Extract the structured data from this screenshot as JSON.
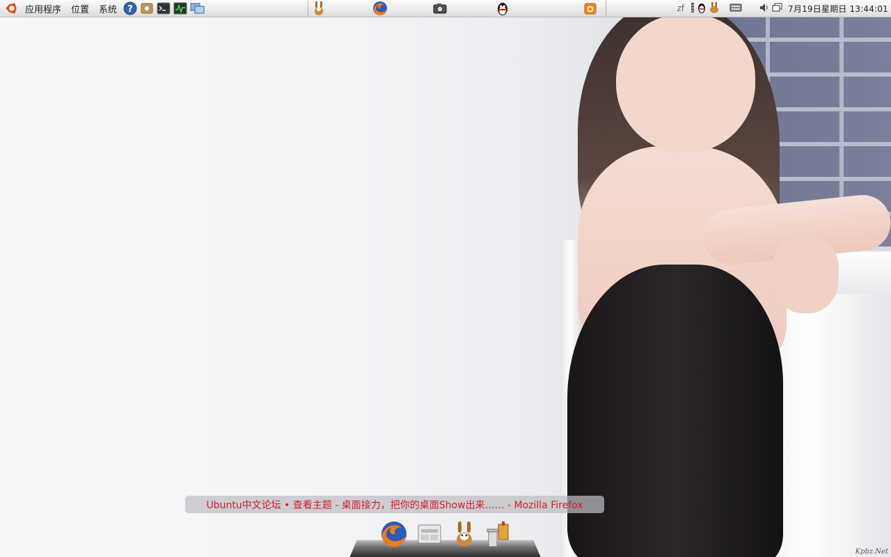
{
  "top_panel": {
    "menus": [
      "应用程序",
      "位置",
      "系统"
    ],
    "launchers": [
      "help-icon",
      "system-settings-icon",
      "terminal-icon",
      "system-monitor-icon",
      "network-manager-icon"
    ],
    "tasks": [
      "amule-icon",
      "firefox-icon",
      "camera-icon",
      "qq-penguin-icon",
      "package-icon"
    ],
    "tray": {
      "user": "zf",
      "icons": [
        "notification-icon",
        "qq-tray-icon",
        "amule-tray-icon",
        "keyboard-icon",
        "volume-icon",
        "window-list-icon"
      ],
      "clock": "7月19日星期日 13:44:01"
    }
  },
  "window_label": "Ubuntu中文论坛 • 查看主题 - 桌面接力，把你的桌面Show出来…… - Mozilla Firefox",
  "dock": {
    "items": [
      "firefox-icon",
      "file-manager-icon",
      "amule-icon",
      "trash-icon"
    ]
  },
  "watermark": "Kpbz.Net",
  "colors": {
    "panel": "#e9e9e9",
    "title_text": "#d11f2a",
    "ubuntu_orange": "#dd4814"
  }
}
